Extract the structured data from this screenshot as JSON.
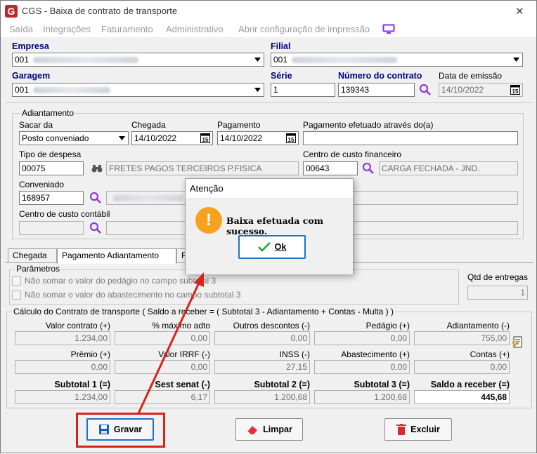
{
  "window": {
    "title": "CGS - Baixa de contrato de transporte",
    "close_glyph": "✕"
  },
  "menu": [
    "Saída",
    "Integrações",
    "Faturamento",
    "Administrativo",
    "Abrir configuração de impressão"
  ],
  "header": {
    "empresa_label": "Empresa",
    "empresa_value": "001",
    "filial_label": "Filial",
    "filial_value": "001",
    "garagem_label": "Garagem",
    "garagem_value": "001",
    "serie_label": "Série",
    "serie_value": "1",
    "numero_label": "Número do contrato",
    "numero_value": "139343",
    "emissao_label": "Data de emissão",
    "emissao_value": "14/10/2022"
  },
  "adiantamento": {
    "group_label": "Adiantamento",
    "sacar_label": "Sacar da",
    "sacar_value": "Posto conveniado",
    "chegada_label": "Chegada",
    "chegada_value": "14/10/2022",
    "pagamento_label": "Pagamento",
    "pagamento_value": "14/10/2022",
    "pag_efetuado_label": "Pagamento efetuado através do(a)",
    "tipo_label": "Tipo de despesa",
    "tipo_code": "00075",
    "tipo_desc": "FRETES PAGOS TERCEIROS P.FISICA",
    "ccf_label": "Centro de custo financeiro",
    "ccf_code": "00643",
    "ccf_desc": "CARGA FECHADA - JND.",
    "conveniado_label": "Conveniado",
    "conveniado_value": "168957",
    "ccc_label": "Centro de custo contábil"
  },
  "tabs": [
    "Chegada",
    "Pagamento Adiantamento",
    "P"
  ],
  "parametros": {
    "group_label": "Parâmetros",
    "opt1": "Não somar o valor do pedágio no campo subtotal 3",
    "opt2": "Não somar o valor do abastecimento no campo subtotal 3",
    "qtd_label": "Qtd de entregas",
    "qtd_value": "1"
  },
  "calculo": {
    "group_label": "Cálculo do Contrato de transporte ( Saldo a receber = ( Subtotal 3 - Adiantamento + Contas - Multa ) )",
    "r1": [
      {
        "label": "Valor contrato (+)",
        "value": "1.234,00"
      },
      {
        "label": "% máximo adto",
        "value": "0,00"
      },
      {
        "label": "Outros descontos (-)",
        "value": "0,00"
      },
      {
        "label": "Pedágio (+)",
        "value": "0,00"
      },
      {
        "label": "Adiantamento (-)",
        "value": "755,00"
      }
    ],
    "r2": [
      {
        "label": "Prêmio (+)",
        "value": "0,00"
      },
      {
        "label": "Valor IRRF (-)",
        "value": "0,00"
      },
      {
        "label": "INSS (-)",
        "value": "27,15"
      },
      {
        "label": "Abastecimento (+)",
        "value": "0,00"
      },
      {
        "label": "Contas (+)",
        "value": "0,00"
      }
    ],
    "r3": [
      {
        "label": "Subtotal 1 (=)",
        "value": "1.234,00"
      },
      {
        "label": "Sest senat (-)",
        "value": "6,17"
      },
      {
        "label": "Subtotal 2 (=)",
        "value": "1.200,68"
      },
      {
        "label": "Subtotal 3 (=)",
        "value": "1.200,68"
      },
      {
        "label": "Saldo a receber (=)",
        "value": "445,68"
      }
    ]
  },
  "buttons": {
    "gravar": "Gravar",
    "limpar": "Limpar",
    "excluir": "Excluir"
  },
  "dialog": {
    "title": "Atenção",
    "message": "Baixa efetuada com sucesso.",
    "ok": "Ok"
  },
  "colors": {
    "label_blue": "#000080",
    "highlight_red": "#d9221c",
    "arrow_red": "#d9221c",
    "warning_orange": "#f6a21e"
  }
}
